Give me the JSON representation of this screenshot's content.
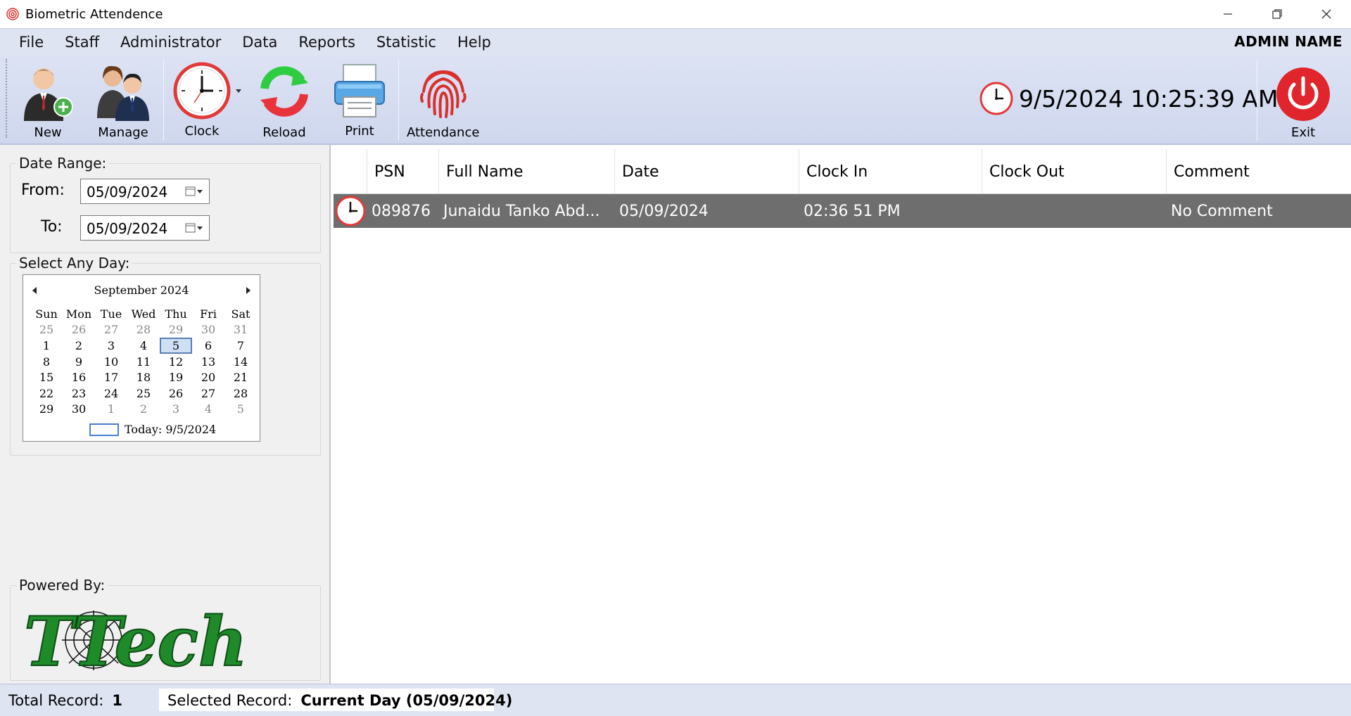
{
  "window": {
    "title": "Biometric Attendence"
  },
  "menu": {
    "items": [
      "File",
      "Staff",
      "Administrator",
      "Data",
      "Reports",
      "Statistic",
      "Help"
    ],
    "admin_name": "ADMIN NAME"
  },
  "toolbar": {
    "new_label": "New",
    "manage_label": "Manage",
    "clock_label": "Clock",
    "reload_label": "Reload",
    "print_label": "Print",
    "attendance_label": "Attendance",
    "exit_label": "Exit",
    "current_datetime": "9/5/2024 10:25:39 AM"
  },
  "date_range": {
    "legend": "Date Range:",
    "from_label": "From:",
    "from_value": "05/09/2024",
    "to_label": "To:",
    "to_value": "05/09/2024"
  },
  "calendar": {
    "legend": "Select Any Day:",
    "month_title": "September 2024",
    "weekdays": [
      "Sun",
      "Mon",
      "Tue",
      "Wed",
      "Thu",
      "Fri",
      "Sat"
    ],
    "weeks": [
      [
        "25",
        "26",
        "27",
        "28",
        "29",
        "30",
        "31"
      ],
      [
        "1",
        "2",
        "3",
        "4",
        "5",
        "6",
        "7"
      ],
      [
        "8",
        "9",
        "10",
        "11",
        "12",
        "13",
        "14"
      ],
      [
        "15",
        "16",
        "17",
        "18",
        "19",
        "20",
        "21"
      ],
      [
        "22",
        "23",
        "24",
        "25",
        "26",
        "27",
        "28"
      ],
      [
        "29",
        "30",
        "1",
        "2",
        "3",
        "4",
        "5"
      ]
    ],
    "selected_day": "5",
    "today_label": "Today: 9/5/2024"
  },
  "powered_by": {
    "legend": "Powered By:",
    "logo_text": "TTech"
  },
  "grid": {
    "columns": [
      "PSN",
      "Full Name",
      "Date",
      "Clock In",
      "Clock Out",
      "Comment"
    ],
    "rows": [
      {
        "psn": "089876",
        "full_name": "Junaidu Tanko Abd...",
        "date": "05/09/2024",
        "clock_in": "02:36 51 PM",
        "clock_out": "",
        "comment": "No Comment"
      }
    ]
  },
  "status": {
    "total_label": "Total Record:",
    "total_value": "1",
    "selected_label": "Selected Record:",
    "selected_value": "Current Day (05/09/2024)"
  },
  "colors": {
    "menu_bg": "#dfe4f3",
    "selected_row_bg": "#6e6e6e",
    "exit_red": "#e0252c",
    "logo_green": "#1e8a2a"
  }
}
